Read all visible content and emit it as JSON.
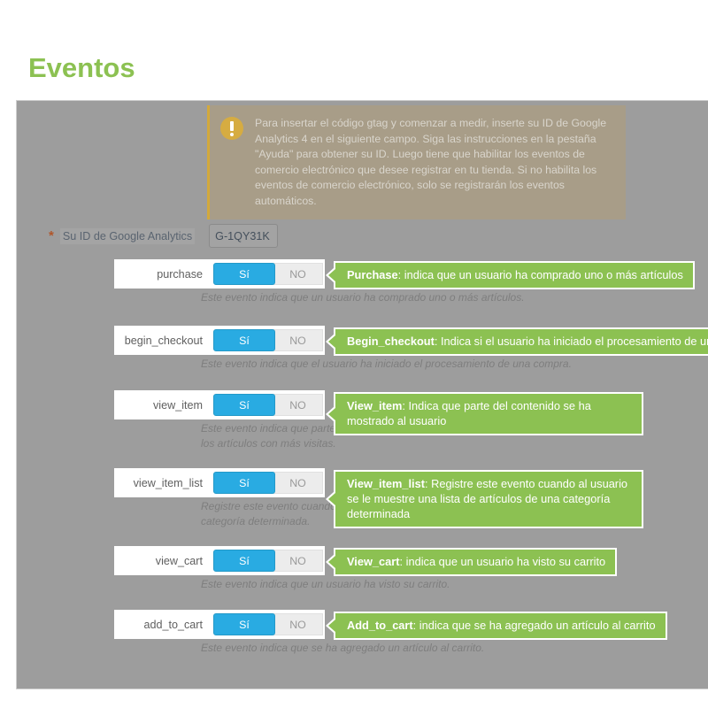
{
  "page": {
    "title": "Eventos"
  },
  "alert": {
    "icon": "exclamation-circle-icon",
    "text": "Para insertar el código gtag y comenzar a medir, inserte su ID de Google Analytics 4 en el siguiente campo. Siga las instrucciones en la pestaña \"Ayuda\" para obtener su ID. Luego tiene que habilitar los eventos de comercio electrónico que desee registrar en tu tienda. Si no habilita los eventos de comercio electrónico, solo se registrarán los eventos automáticos.",
    "accent_color": "#d2a93c",
    "background_color": "#a89d88"
  },
  "analytics_id": {
    "required_marker": "*",
    "label": "Su ID de Google Analytics",
    "value": "G-1QY31K",
    "placeholder": ""
  },
  "switch": {
    "yes_label": "Sí",
    "no_label": "NO",
    "on_color": "#29abe2",
    "off_color": "#ececec"
  },
  "colors": {
    "brand_green": "#8cc152",
    "panel_gray": "#9d9d9d",
    "switch_blue": "#29abe2"
  },
  "events": [
    {
      "name": "purchase",
      "state": "yes",
      "callout_title": "Purchase",
      "callout_text": ": indica que un usuario ha comprado uno o más artículos",
      "description": "Este evento indica que un usuario ha comprado uno o más artículos."
    },
    {
      "name": "begin_checkout",
      "state": "yes",
      "callout_title": "Begin_checkout",
      "callout_text": ": Indica si el usuario ha iniciado el procesamiento de una compra",
      "description": "Este evento indica que el usuario ha iniciado el procesamiento de una compra."
    },
    {
      "name": "view_item",
      "state": "yes",
      "callout_title": "View_item",
      "callout_text": ": Indica que parte del contenido se ha mostrado al usuario",
      "description": "Este evento indica que parte del contenido se ha mostrado al usuario. Uselo para descubrir los artículos con más visitas."
    },
    {
      "name": "view_item_list",
      "state": "yes",
      "callout_title": "View_item_list",
      "callout_text": ": Registre este evento cuando al usuario se le muestre una lista de artículos de una categoría determinada",
      "description": "Registre este evento cuando al usuario se le muestre una lista de artículos de una categoría determinada."
    },
    {
      "name": "view_cart",
      "state": "yes",
      "callout_title": "View_cart",
      "callout_text": ": indica que un usuario ha visto su carrito",
      "description": "Este evento indica que un usuario ha visto su carrito."
    },
    {
      "name": "add_to_cart",
      "state": "yes",
      "callout_title": "Add_to_cart",
      "callout_text": ": indica que se ha agregado un artículo al carrito",
      "description": "Este evento indica que se ha agregado un artículo al carrito."
    }
  ]
}
